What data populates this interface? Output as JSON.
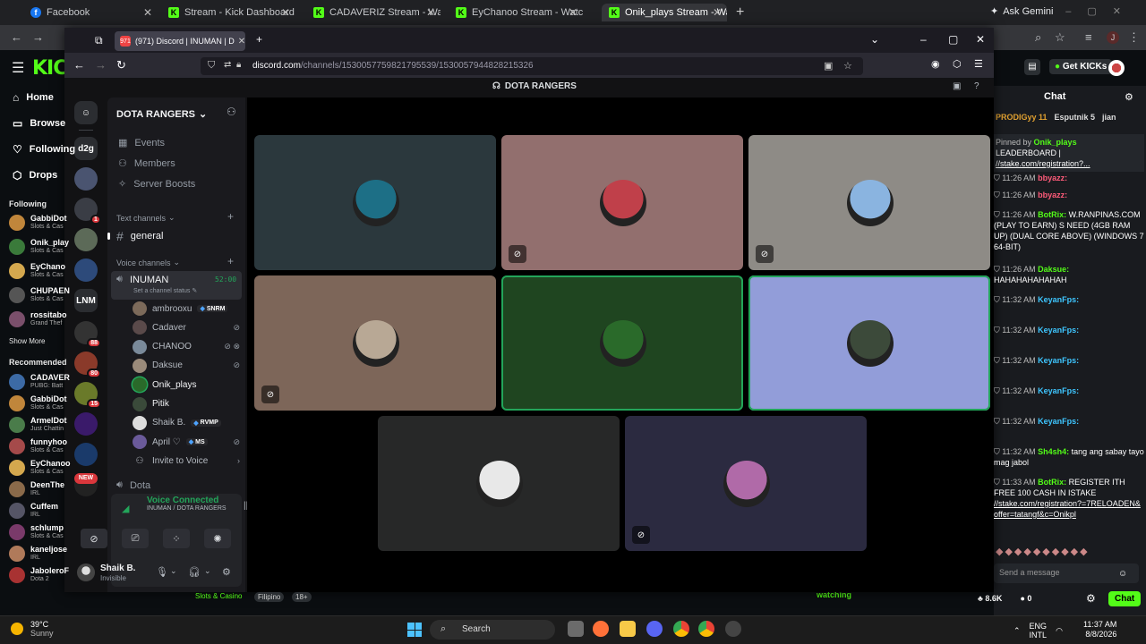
{
  "outer_browser": {
    "tabs": [
      {
        "title": "Facebook",
        "fav": "fb"
      },
      {
        "title": "Stream - Kick Dashboard",
        "fav": "k"
      },
      {
        "title": "CADAVERIZ Stream - Watch Live",
        "fav": "k"
      },
      {
        "title": "EyChanoo Stream - Watch Live",
        "fav": "k"
      },
      {
        "title": "Onik_plays Stream - Watch Live",
        "fav": "k",
        "active": true
      }
    ],
    "gemini": "Ask Gemini"
  },
  "kick": {
    "nav": [
      "Home",
      "Browse",
      "Following",
      "Drops"
    ],
    "following_label": "Following",
    "following": [
      {
        "name": "GabbiDot",
        "cat": "Slots & Cas",
        "color": "#c0863b"
      },
      {
        "name": "Onik_play",
        "cat": "Slots & Cas",
        "color": "#3a7a3a"
      },
      {
        "name": "EyChano",
        "cat": "Slots & Cas",
        "color": "#d4a84e"
      },
      {
        "name": "CHUPAEN",
        "cat": "Slots & Cas",
        "color": "#555"
      },
      {
        "name": "rossitabo",
        "cat": "Grand Thef",
        "color": "#7a4f6b"
      }
    ],
    "show_more": "Show More",
    "recommended_label": "Recommended",
    "recommended": [
      {
        "name": "CADAVER",
        "cat": "PUBG: Batt",
        "color": "#3c6aa5"
      },
      {
        "name": "GabbiDot",
        "cat": "Slots & Cas",
        "color": "#c0863b"
      },
      {
        "name": "ArmelDot",
        "cat": "Just Chattin",
        "color": "#4a7c4a"
      },
      {
        "name": "funnyhoo",
        "cat": "Slots & Cas",
        "color": "#a54a4a"
      },
      {
        "name": "EyChanoo",
        "cat": "Slots & Cas",
        "color": "#d4a84e"
      },
      {
        "name": "DeenThe",
        "cat": "IRL",
        "color": "#8a6a4a"
      },
      {
        "name": "Cuffem",
        "cat": "IRL",
        "color": "#556"
      },
      {
        "name": "schlump",
        "cat": "Slots & Cas",
        "color": "#7a3a6a"
      },
      {
        "name": "kaneljose",
        "cat": "IRL",
        "color": "#b07a5a"
      },
      {
        "name": "JaboleroF",
        "cat": "Dota 2",
        "color": "#a83232"
      }
    ],
    "get_kicks": "Get KICKs",
    "bottom_tags": [
      "Slots & Casino",
      "Filipino",
      "18+"
    ],
    "watching": "watching",
    "stats_viewers": "8.6K",
    "stats_zero": "0",
    "chat": {
      "title": "Chat",
      "gifters": [
        "PRODIGyy 11",
        "Esputnik 5",
        "jian"
      ],
      "pinned_by": "Pinned by",
      "pinned_user": "Onik_plays",
      "pinned_line1": "LEADERBOARD |",
      "pinned_line2": "//stake.com/registration?...",
      "messages": [
        {
          "time": "11:26 AM",
          "user": "bbyazz:",
          "text": "",
          "cls": "u2"
        },
        {
          "time": "11:26 AM",
          "user": "bbyazz:",
          "text": "",
          "cls": "u2"
        },
        {
          "time": "11:26 AM",
          "user": "BotRix:",
          "text": "W.RANPINAS.COM (PLAY TO EARN) S NEED (4GB RAM UP) (DUAL CORE ABOVE) (WINDOWS 7 64-BIT)",
          "cls": "u"
        },
        {
          "time": "11:26 AM",
          "user": "Daksue:",
          "text": "HAHAHAHAHAHAH",
          "cls": "u"
        },
        {
          "time": "11:32 AM",
          "user": "KeyanFps:",
          "text": "",
          "cls": "u3"
        },
        {
          "time": "11:32 AM",
          "user": "KeyanFps:",
          "text": "",
          "cls": "u3"
        },
        {
          "time": "11:32 AM",
          "user": "KeyanFps:",
          "text": "",
          "cls": "u3"
        },
        {
          "time": "11:32 AM",
          "user": "KeyanFps:",
          "text": "",
          "cls": "u3"
        },
        {
          "time": "11:32 AM",
          "user": "KeyanFps:",
          "text": "",
          "cls": "u3"
        },
        {
          "time": "11:32 AM",
          "user": "Sh4sh4:",
          "text": "tang ang sabay tayo mag jabol",
          "cls": "u"
        },
        {
          "time": "11:33 AM",
          "user": "BotRix:",
          "text": "REGISTER ITH FREE 100 CASH IN ISTAKE",
          "cls": "u",
          "link": "//stake.com/registration?=7RELOADEN&offer=tatangf&c=Onikpl"
        }
      ],
      "input_placeholder": "Send a message",
      "chat_button": "Chat"
    }
  },
  "firefox": {
    "tab_title": "(971) Discord | INUMAN | D",
    "url_host": "discord.com",
    "url_path": "/channels/1530057759821795539/1530057944828215326"
  },
  "discord": {
    "window_title": "DOTA RANGERS",
    "server_name": "DOTA RANGERS",
    "guilds": [
      {
        "label": "d2g",
        "color": "#2b2d31",
        "badge": ""
      },
      {
        "label": "",
        "color": "#4a5470",
        "badge": ""
      },
      {
        "label": "",
        "color": "#3a3d45",
        "badge": "1"
      },
      {
        "label": "",
        "color": "#5c6a58",
        "badge": ""
      },
      {
        "label": "",
        "color": "#2d4a7a",
        "badge": ""
      },
      {
        "label": "LNM",
        "color": "#2b2d31",
        "badge": ""
      },
      {
        "label": "",
        "color": "#333",
        "badge": "88"
      },
      {
        "label": "",
        "color": "#8a3a2a",
        "badge": "80"
      },
      {
        "label": "",
        "color": "#6a7a2a",
        "badge": "15"
      },
      {
        "label": "",
        "color": "#3a1a6a",
        "badge": ""
      },
      {
        "label": "",
        "color": "#1a3a6a",
        "badge": ""
      },
      {
        "label": "",
        "color": "#222",
        "badge": ""
      }
    ],
    "new_badge": "NEW",
    "menu": [
      "Events",
      "Members",
      "Server Boosts"
    ],
    "text_channels_label": "Text channels",
    "text_channel": "general",
    "voice_channels_label": "Voice channels",
    "voice_channel": "INUMAN",
    "voice_time": "52:00",
    "channel_status": "Set a channel status",
    "voice_users": [
      {
        "name": "ambrooxu",
        "tag": "SNRM",
        "icon": "",
        "color": "#7c6a5a"
      },
      {
        "name": "Cadaver",
        "tag": "",
        "icon": "muted",
        "color": "#5a4a4a"
      },
      {
        "name": "CHANOO",
        "tag": "",
        "icon": "muted-deaf",
        "color": "#7a8a9a"
      },
      {
        "name": "Daksue",
        "tag": "",
        "icon": "muted",
        "color": "#9a8a7a"
      },
      {
        "name": "Onik_plays",
        "tag": "",
        "icon": "",
        "color": "#2a6a2a"
      },
      {
        "name": "Pitik",
        "tag": "",
        "icon": "",
        "color": "#3a4a3a"
      },
      {
        "name": "Shaik B.",
        "tag": "RVMP",
        "icon": "",
        "color": "#ddd"
      },
      {
        "name": "April ♡",
        "tag": "MS",
        "icon": "muted",
        "color": "#6a5a9a"
      }
    ],
    "invite": "Invite to Voice",
    "next_channel": "Dota",
    "voice_status": "Voice Connected",
    "voice_location": "INUMAN / DOTA RANGERS",
    "me_name": "Shaik B.",
    "me_status": "Invisible",
    "tiles": [
      {
        "name": "ambrooxu",
        "bg": "#2b383d",
        "av": "#1d6f86",
        "muted": false,
        "speaking": false
      },
      {
        "name": "Cadaver",
        "bg": "#926f6e",
        "av": "#c0404a",
        "muted": true,
        "speaking": false
      },
      {
        "name": "CHANOO",
        "bg": "#8e8b86",
        "av": "#8ab4e0",
        "muted": true,
        "speaking": false
      },
      {
        "name": "Daksue",
        "bg": "#7d6659",
        "av": "#b8a895",
        "muted": true,
        "speaking": false
      },
      {
        "name": "Onik_plays",
        "bg": "#1f4520",
        "av": "#2a6a2a",
        "muted": false,
        "speaking": true
      },
      {
        "name": "Pitik",
        "bg": "#929dd9",
        "av": "#3c4a3a",
        "muted": false,
        "speaking": true
      },
      {
        "name": "Shaik B.",
        "bg": "#272828",
        "av": "#e8e8e8",
        "muted": false,
        "speaking": false
      },
      {
        "name": "April ♡",
        "bg": "#2b2a40",
        "av": "#b06aa8",
        "muted": true,
        "speaking": false
      }
    ]
  },
  "taskbar": {
    "temp": "39°C",
    "condition": "Sunny",
    "search": "Search",
    "lang1": "ENG",
    "lang2": "INTL",
    "time": "11:37 AM",
    "date": "8/8/2026"
  }
}
